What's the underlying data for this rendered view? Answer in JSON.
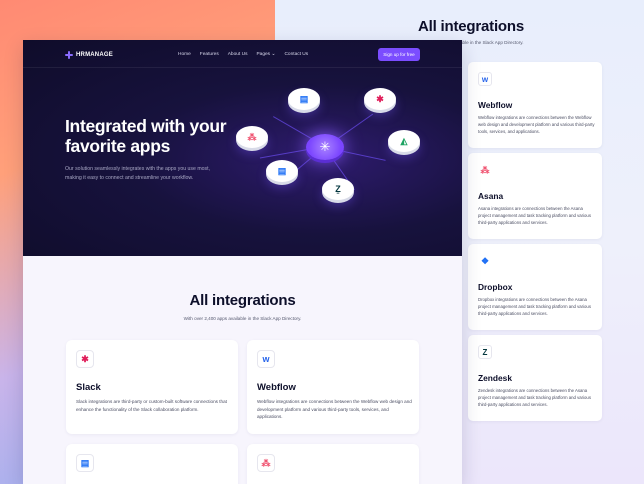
{
  "colors": {
    "accent": "#7b4dff",
    "hero_bg": "#0f0c2a",
    "heading": "#0d0f2a"
  },
  "nav": {
    "brand": "HRMANAGE",
    "items": [
      "Home",
      "Features",
      "About Us",
      "Pages ⌄",
      "Contact Us"
    ],
    "signup": "Sign up for free"
  },
  "hero": {
    "title": "Integrated with your favorite apps",
    "lead": "Our solution seamlessly integrates with the apps you use most, making it easy to connect and streamline your workflow.",
    "hub_icon": "asterisk-icon",
    "apps": [
      {
        "icon": "trello-icon"
      },
      {
        "icon": "slack-icon"
      },
      {
        "icon": "asana-icon"
      },
      {
        "icon": "google-drive-icon"
      },
      {
        "icon": "trello-icon"
      },
      {
        "icon": "zendesk-icon"
      }
    ]
  },
  "integrations": {
    "title": "All integrations",
    "subtitle": "With over 2,400 apps available in the Slack App Directory.",
    "cards": [
      {
        "name": "Slack",
        "icon": "slack-icon",
        "desc": "Slack integrations are third-party or custom-built software connections that enhance the functionality of the Slack collaboration platform."
      },
      {
        "name": "Webflow",
        "icon": "webflow-icon",
        "desc": "Webflow integrations are connections between the Webflow web design and development platform and various third-party tools, services, and applications."
      },
      {
        "name": "",
        "icon": "trello-icon",
        "desc": ""
      },
      {
        "name": "",
        "icon": "asana-icon",
        "desc": ""
      }
    ]
  },
  "back_panel": {
    "title": "All integrations",
    "subtitle_fragment": "able in the Slack App Directory.",
    "cards": [
      {
        "name": "Webflow",
        "icon": "webflow-icon",
        "desc": "Webflow integrations are connections between the Webflow web design and development platform and various third-party tools, services, and applications."
      },
      {
        "name": "Asana",
        "icon": "asana-icon",
        "desc": "Asana integrations are connections between the Asana project management and task tracking platform and various third-party applications and services."
      },
      {
        "name": "Dropbox",
        "icon": "dropbox-icon",
        "desc": "Dropbox integrations are connections between the Asana project management and task tracking platform and various third-party applications and services."
      },
      {
        "name": "Zendesk",
        "icon": "zendesk-icon",
        "desc": "Zendesk integrations are connections between the Asana project management and task tracking platform and various third-party applications and services."
      }
    ]
  }
}
